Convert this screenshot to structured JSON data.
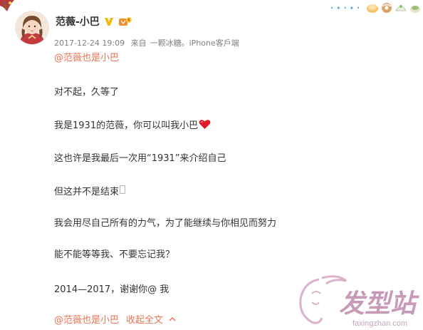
{
  "decor": {
    "top_right_text": "• ✦ • ✦ •"
  },
  "post": {
    "username": "范薇-小巴",
    "timestamp": "2017-12-24 19:09",
    "source_prefix": "来自",
    "source": "一颗冰糖。iPhone客戶端",
    "lines": {
      "mention": "@范薇也是小巴",
      "l1": "对不起，久等了",
      "l2": "我是1931的范薇，你可以叫我小巴",
      "l3": "这也许是我最后一次用“1931”来介绍自己",
      "l4": "但这并不是结束",
      "l5": "我会用尽自己所有的力气，为了能继续与你相见而努力",
      "l6": "能不能等等我、不要忘记我？",
      "l7": "2014—2017，谢谢你@ 我"
    },
    "footer_mention": "@范薇也是小巴",
    "collapse_label": "收起全文"
  },
  "colors": {
    "mention": "#eb7350",
    "meta": "#808080",
    "text": "#333333",
    "watermark": "#c79bb8"
  },
  "watermark": {
    "logo_text": "发型站",
    "url": "faxingzhan.com"
  }
}
